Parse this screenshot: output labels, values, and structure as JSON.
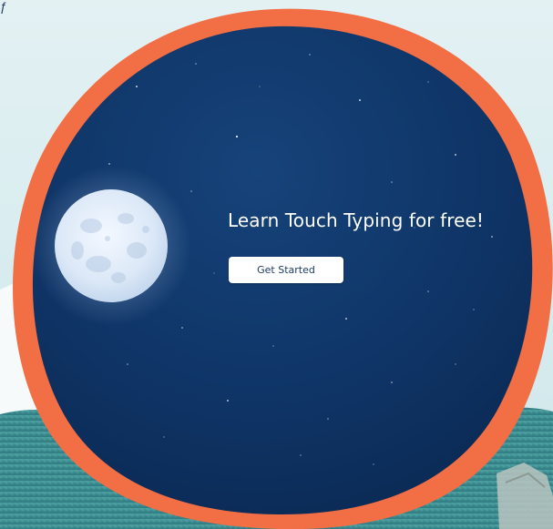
{
  "corner_glyph": "ƒ",
  "hero": {
    "headline": "Learn Touch Typing for free!",
    "cta_label": "Get Started"
  },
  "colors": {
    "sky_background": "#dcedf0",
    "portal_ring": "#f26e45",
    "night_sky": "#0f3567",
    "moon": "#e6f0fb",
    "hills": "#3c8e92",
    "snow_hill": "#f5f9fa",
    "button_text": "#1d3b66"
  }
}
